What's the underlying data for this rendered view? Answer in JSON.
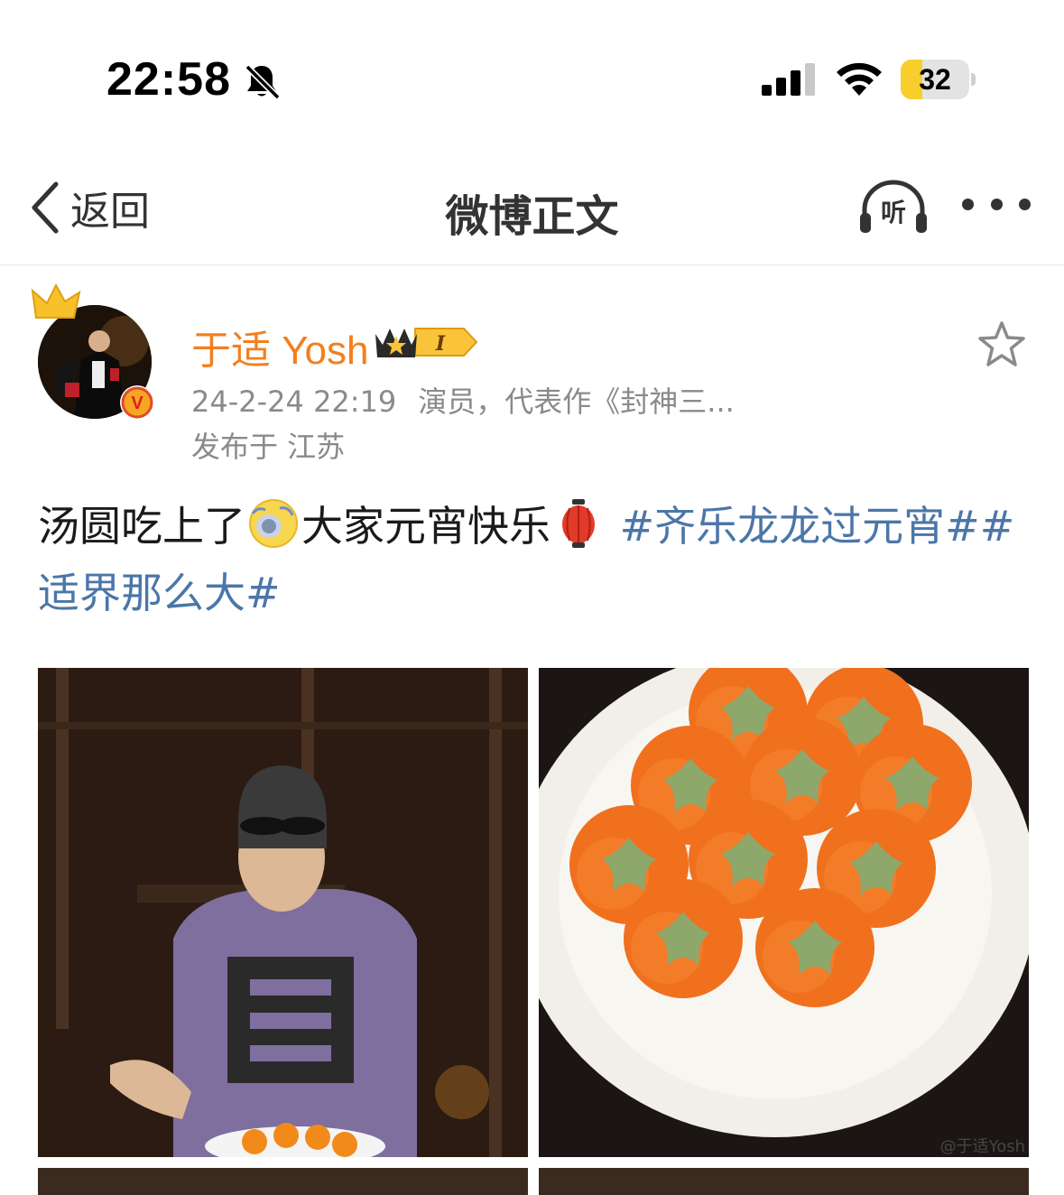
{
  "status_bar": {
    "time": "22:58",
    "battery_level": "32",
    "battery_fraction": 0.32,
    "icons": [
      "bell-slash-icon",
      "cellular-signal-icon",
      "wifi-icon",
      "battery-icon"
    ]
  },
  "nav": {
    "back_label": "返回",
    "title": "微博正文",
    "listen_label": "听",
    "icons": [
      "chevron-left-icon",
      "headphones-icon",
      "more-dots-icon"
    ]
  },
  "post": {
    "author": "于适 Yosh",
    "badge_label": "I",
    "time": "24-2-24 22:19",
    "source": "演员，代表作《封神三...",
    "location": "发布于 江苏",
    "text_part1": "汤圆吃上了",
    "text_part2": "大家元宵快乐",
    "hashtag1": "#齐乐龙龙过元宵#",
    "hashtag2": "#适界那么大#",
    "watermark": "@于适Yosh",
    "colors": {
      "username": "#f37f1e",
      "hashtag": "#4b76a8",
      "meta": "#8a8a8a",
      "verified": "#f5a623"
    }
  }
}
